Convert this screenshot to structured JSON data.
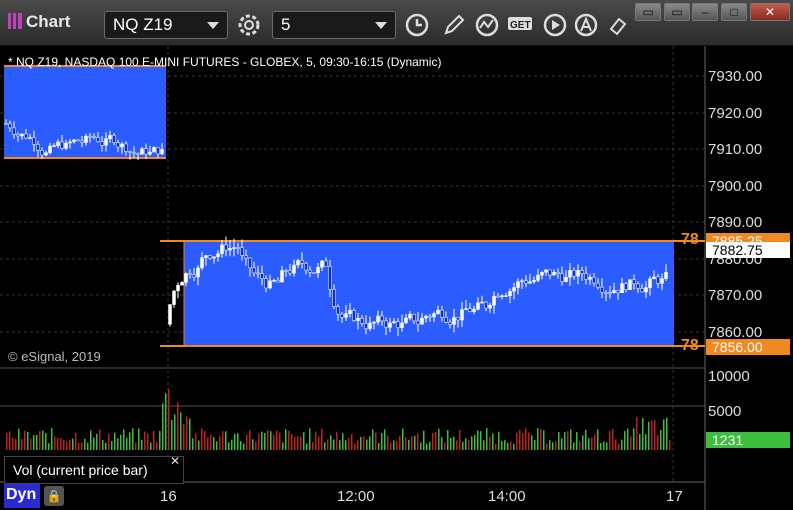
{
  "app": {
    "title": "Chart"
  },
  "toolbar": {
    "symbol": "NQ Z19",
    "interval": "5",
    "tools": [
      "clock-icon",
      "pencil-icon",
      "study-icon",
      "get-icon",
      "play-icon",
      "alert-icon",
      "eraser-icon"
    ]
  },
  "chart": {
    "header": "* NQ Z19, NASDAQ 100 E-MINI FUTURES - GLOBEX, 5, 09:30-16:15 (Dynamic)",
    "copyright": "© eSignal, 2019",
    "price_axis": [
      "7930.00",
      "7920.00",
      "7910.00",
      "7900.00",
      "7890.00",
      "7880.00",
      "7870.00",
      "7860.00"
    ],
    "volume_axis": [
      "10000",
      "5000"
    ],
    "time_axis": [
      "16",
      "12:00",
      "14:00",
      "17"
    ],
    "current_price": "7882.75",
    "upper_level": "7885.25",
    "lower_level": "7856.00",
    "level_tag_upper": "78",
    "level_tag_lower": "78",
    "current_volume": "1231",
    "colors": {
      "range_box": "#2b5cff",
      "level_line": "#f08a20",
      "up_volume": "#3cbf3c",
      "down_volume": "#c02020",
      "volume_tag": "#3cbf3c"
    }
  },
  "volume_panel": {
    "label": "Vol (current price bar)"
  },
  "footer": {
    "mode": "Dyn"
  }
}
